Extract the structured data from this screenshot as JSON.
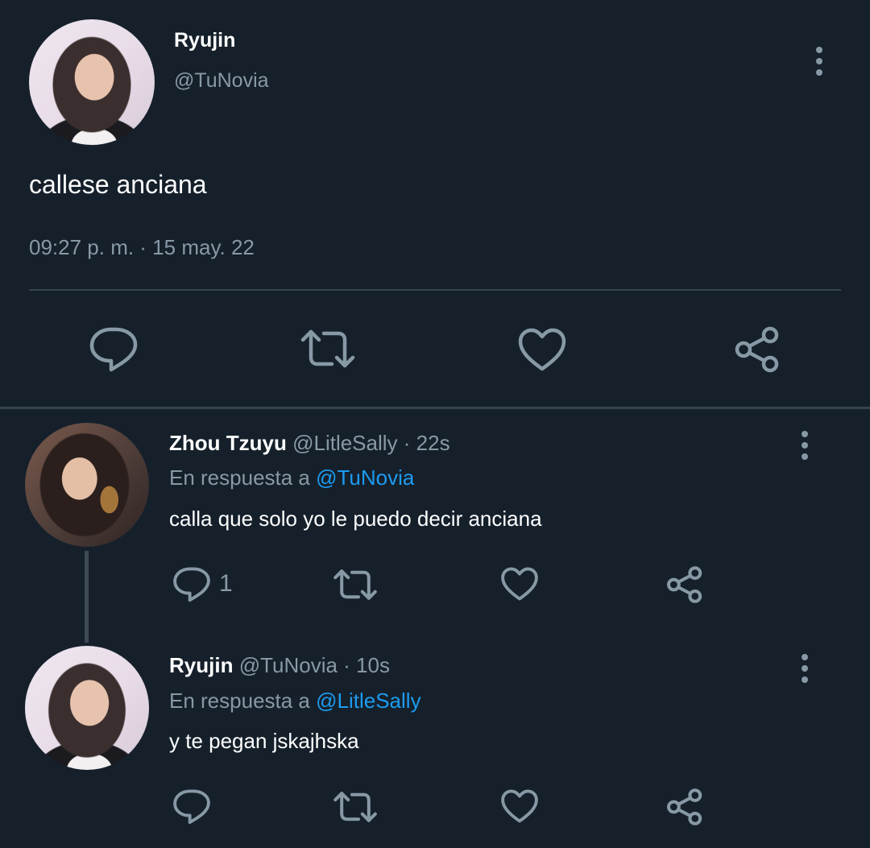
{
  "main_tweet": {
    "author_name": "Ryujin",
    "author_handle": "@TuNovia",
    "text": "callese anciana",
    "timestamp": "09:27 p. m. · 15 may. 22",
    "actions": [
      "reply-icon",
      "retweet-icon",
      "like-icon",
      "share-icon"
    ]
  },
  "replies": [
    {
      "author_name": "Zhou Tzuyu",
      "author_handle": "@LitleSally",
      "time": "· 22s",
      "reply_prefix": "En respuesta a",
      "reply_to": "@TuNovia",
      "text": "calla que solo yo le puedo decir anciana",
      "reply_count": "1"
    },
    {
      "author_name": "Ryujin",
      "author_handle": "@TuNovia",
      "time": "· 10s",
      "reply_prefix": "En respuesta a",
      "reply_to": "@LitleSally",
      "text": "y te pegan jskajhska",
      "reply_count": ""
    }
  ],
  "colors": {
    "background": "#15202b",
    "muted": "#8899a6",
    "link": "#1d9bf0",
    "divider": "#38444d"
  }
}
